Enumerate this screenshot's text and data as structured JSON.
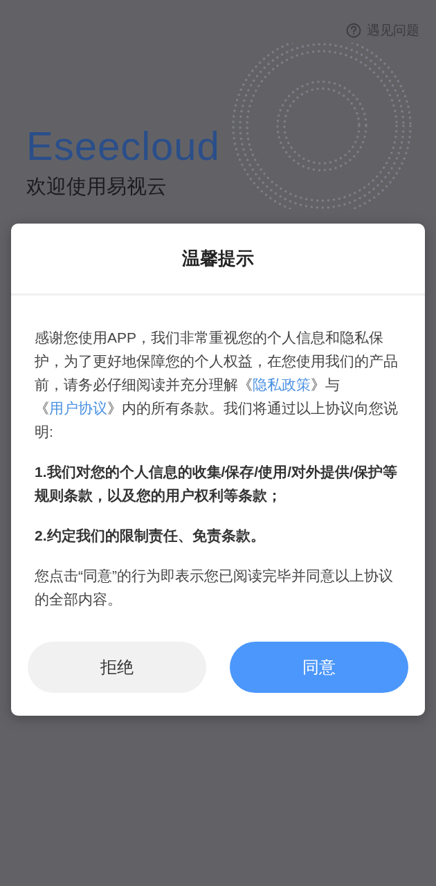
{
  "help_link": {
    "label": "遇见问题"
  },
  "brand": {
    "logo": "Eseecloud",
    "welcome": "欢迎使用易视云"
  },
  "dialog": {
    "title": "温馨提示",
    "intro": [
      {
        "kind": "text",
        "text": "感谢您使用APP，我们非常重视您的个人信息和隐私保护，为了更好地保障您的个人权益，在您使用我们的产品前，请务必仔细阅读并充分理解《"
      },
      {
        "kind": "link",
        "text": "隐私政策"
      },
      {
        "kind": "text",
        "text": "》与《"
      },
      {
        "kind": "link",
        "text": "用户协议"
      },
      {
        "kind": "text",
        "text": "》内的所有条款。我们将通过以上协议向您说明:"
      }
    ],
    "points": [
      "1.我们对您的个人信息的收集/保存/使用/对外提供/保护等规则条款，以及您的用户权利等条款；",
      "2.约定我们的限制责任、免责条款。"
    ],
    "closing": "您点击“同意”的行为即表示您已阅读完毕并同意以上协议的全部内容。",
    "buttons": [
      {
        "label": "拒绝",
        "kind": "secondary"
      },
      {
        "label": "同意",
        "kind": "primary"
      }
    ]
  }
}
